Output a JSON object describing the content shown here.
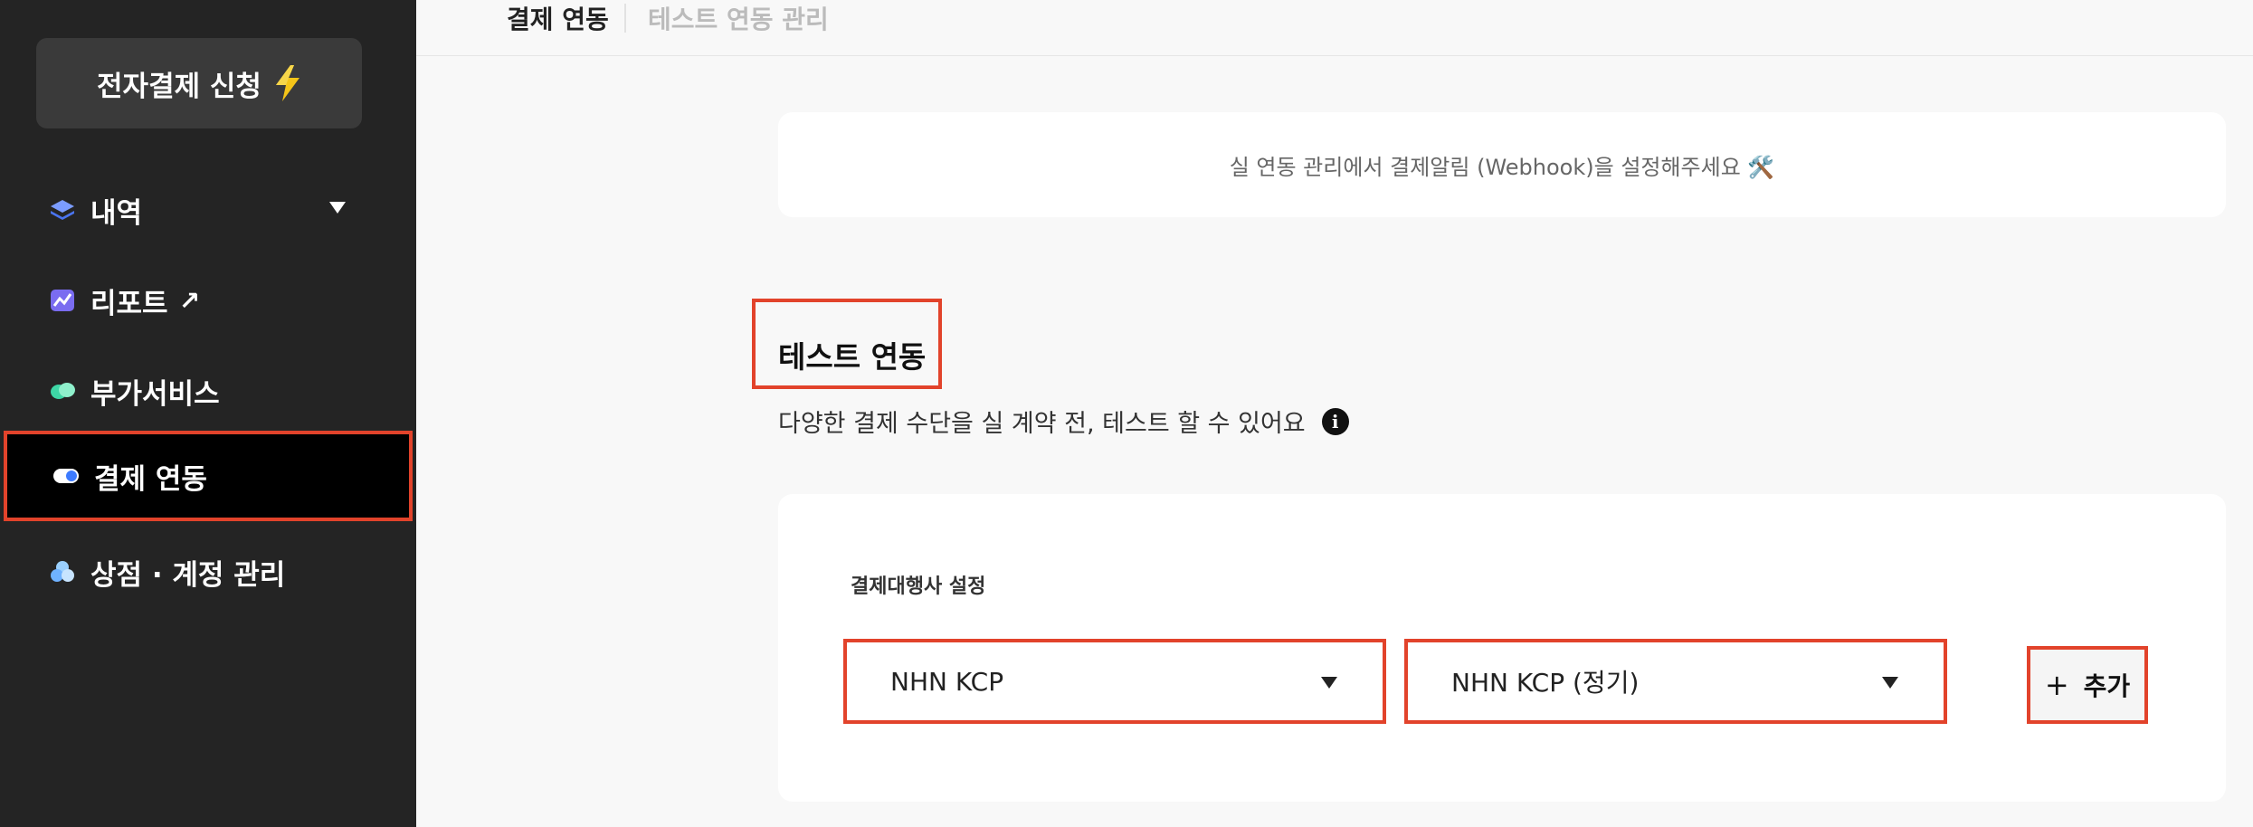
{
  "sidebar": {
    "apply_button": {
      "label": "전자결제 신청",
      "icon": "lightning-icon"
    },
    "items": [
      {
        "label": "내역",
        "icon": "layers-icon",
        "has_dropdown": true
      },
      {
        "label": "리포트",
        "icon": "chart-icon",
        "external_glyph": "↗"
      },
      {
        "label": "부가서비스",
        "icon": "cloud-icon"
      },
      {
        "label": "결제 연동",
        "icon": "toggle-icon",
        "active": true
      },
      {
        "label": "상점 · 계정 관리",
        "icon": "store-icon"
      }
    ]
  },
  "tabs": [
    {
      "label": "결제 연동",
      "active": true
    },
    {
      "label": "테스트 연동 관리",
      "active": false
    }
  ],
  "notice": {
    "text": "실 연동 관리에서 결제알림 (Webhook)을 설정해주세요 🛠️"
  },
  "section": {
    "title": "테스트 연동",
    "description": "다양한 결제 수단을 실 계약 전, 테스트 할 수 있어요",
    "info_glyph": "i"
  },
  "pg_settings": {
    "label": "결제대행사 설정",
    "provider_select": {
      "value": "NHN KCP"
    },
    "product_select": {
      "value": "NHN KCP (정기)"
    },
    "add_button": {
      "plus": "+",
      "label": "추가"
    }
  },
  "colors": {
    "sidebar_bg": "#242424",
    "highlight_border": "#e2432b",
    "page_bg": "#f8f8f8"
  }
}
